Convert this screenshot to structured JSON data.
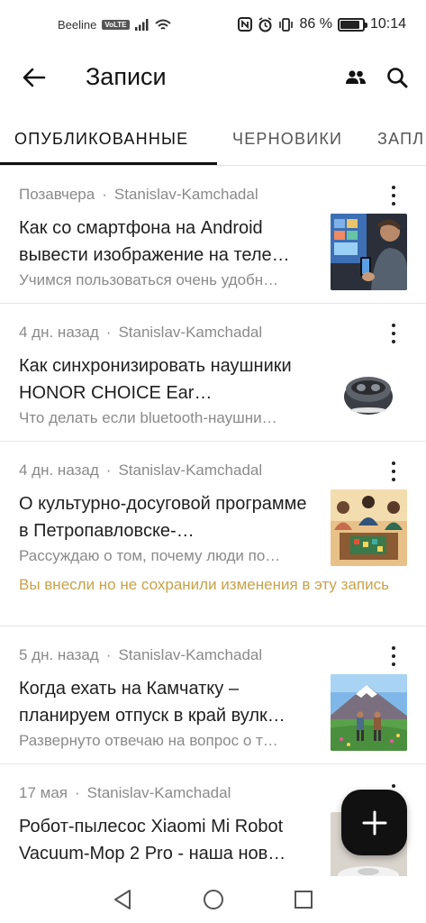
{
  "status_bar": {
    "carrier": "Beeline",
    "volte": "VoLTE",
    "battery_level": "86 %",
    "battery_fraction": 0.86,
    "time": "10:14",
    "icons": [
      "signal-icon",
      "wifi-icon",
      "nfc-icon",
      "alarm-icon",
      "vibrate-icon",
      "battery-icon"
    ]
  },
  "header": {
    "title": "Записи",
    "icons": [
      "back-arrow-icon",
      "people-icon",
      "search-icon"
    ]
  },
  "tabs": [
    {
      "label": "ОПУБЛИКОВАННЫЕ",
      "active": true
    },
    {
      "label": "ЧЕРНОВИКИ",
      "active": false
    },
    {
      "label": "ЗАПЛ",
      "active": false
    }
  ],
  "posts": [
    {
      "date": "Позавчера",
      "author": "Stanislav-Kamchadal",
      "title": "Как со смартфона на Android вывести изображение на теле…",
      "excerpt": "Учимся пользоваться очень удобн…",
      "thumbnail": "phone-to-tv-photo"
    },
    {
      "date": "4 дн. назад",
      "author": "Stanislav-Kamchadal",
      "title": "Как синхронизировать наушники HONOR CHOICE Ear…",
      "excerpt": "Что делать если bluetooth-наушни…",
      "thumbnail": "earbuds-case-photo"
    },
    {
      "date": "4 дн. назад",
      "author": "Stanislav-Kamchadal",
      "title": "О культурно-досуговой программе в Петропавловске-…",
      "excerpt": "Рассуждаю о том, почему люди по…",
      "warning": "Вы внесли но не сохранили изменения в эту запись",
      "thumbnail": "board-game-photo"
    },
    {
      "date": "5 дн. назад",
      "author": "Stanislav-Kamchadal",
      "title": "Когда ехать на Камчатку – планируем отпуск в край вулк…",
      "excerpt": "Развернуто отвечаю на вопрос о т…",
      "thumbnail": "volcano-hikers-photo"
    },
    {
      "date": "17 мая",
      "author": "Stanislav-Kamchadal",
      "title": "Робот-пылесос Xiaomi Mi Robot Vacuum-Mop 2 Pro - наша нов…",
      "excerpt": "",
      "thumbnail": "robot-vacuum-photo"
    }
  ],
  "fab": {
    "icon": "plus-icon"
  },
  "nav_bar": {
    "icons": [
      "nav-back-icon",
      "nav-home-icon",
      "nav-recent-icon"
    ]
  },
  "colors": {
    "text_primary": "#1f1f1f",
    "text_secondary": "#8a8a8a",
    "warning": "#c8a24a",
    "fab_background": "#111111",
    "divider": "#e6e6e6"
  }
}
